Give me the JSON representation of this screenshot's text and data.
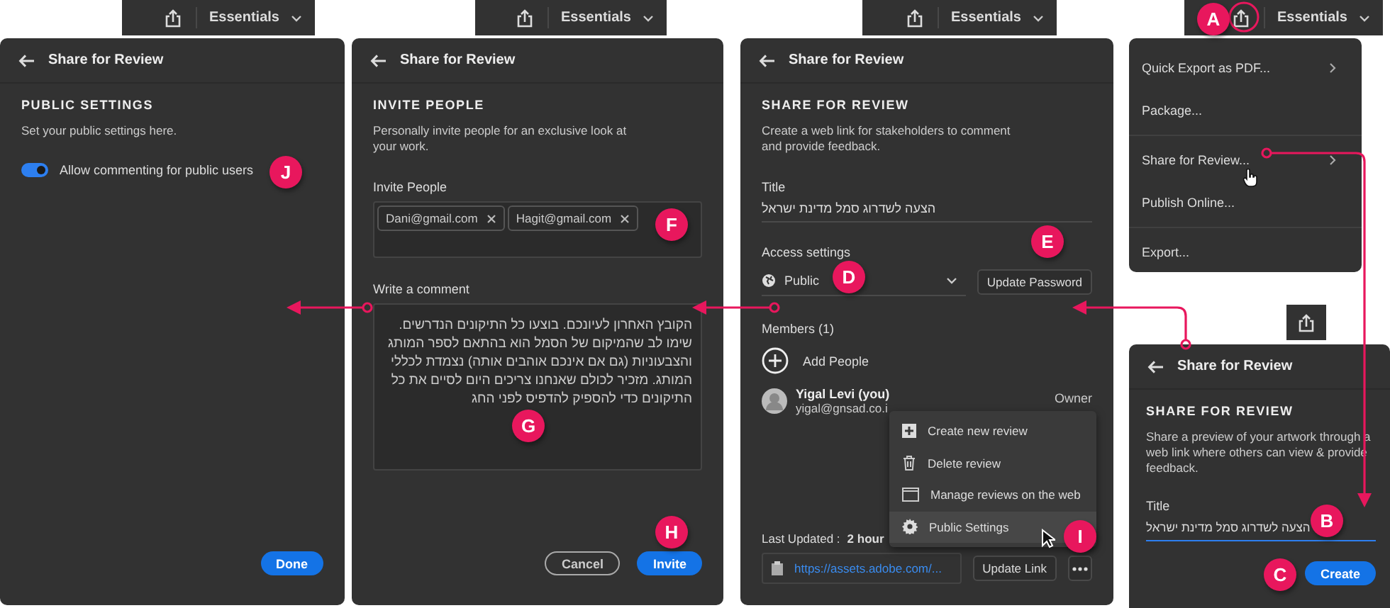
{
  "public_settings_panel": {
    "toolbar": {
      "label": "Essentials"
    },
    "header": "Share for Review",
    "heading": "PUBLIC SETTINGS",
    "description": "Set your public settings here.",
    "toggle": {
      "label": "Allow commenting for public users",
      "on": true
    },
    "done_button": "Done"
  },
  "invite_panel": {
    "toolbar": {
      "label": "Essentials"
    },
    "header": "Share for Review",
    "heading": "INVITE PEOPLE",
    "description": "Personally invite people for an exclusive look at your work.",
    "invite_label": "Invite People",
    "tags": [
      {
        "label": "Dani@gmail.com"
      },
      {
        "label": "Hagit@gmail.com"
      }
    ],
    "comment_label": "Write a comment",
    "comment": "הקובץ האחרון לעיונכם. בוצעו כל התיקונים הנדרשים. שימו לב שהמיקום של הסמל הוא בהתאם לספר המותג והצבעוניות (גם אם אינכם אוהבים אותה) נצמדת לכללי המותג. מזכיר לכולם שאנחנו צריכים היום לסיים את כל התיקונים כדי להספיק להדפיס לפני החג",
    "cancel_button": "Cancel",
    "invite_button": "Invite"
  },
  "review_panel": {
    "toolbar": {
      "label": "Essentials"
    },
    "header": "Share for Review",
    "heading": "SHARE FOR REVIEW",
    "description": "Create a web link for stakeholders to comment and provide feedback.",
    "title_label": "Title",
    "title_value": "הצעה לשדרוג סמל מדינת ישראל",
    "access_label": "Access settings",
    "access_value": "Public",
    "update_password_button": "Update Password",
    "members_label": "Members (1)",
    "add_people": "Add People",
    "member": {
      "name": "Yigal Levi (you)",
      "email": "yigal@gnsad.co.i",
      "role": "Owner"
    },
    "last_updated_label": "Last Updated :",
    "last_updated_value": "2 hour",
    "link": "https://assets.adobe.com/...",
    "update_link_button": "Update Link",
    "context_menu": [
      {
        "kind": "new",
        "label": "Create new review",
        "selected": false
      },
      {
        "kind": "delete",
        "label": "Delete review",
        "selected": false
      },
      {
        "kind": "manage",
        "label": "Manage reviews on the web",
        "selected": false
      },
      {
        "kind": "settings",
        "label": "Public Settings",
        "selected": true
      }
    ]
  },
  "export_menu": {
    "toolbar": {
      "label": "Essentials"
    },
    "groups": [
      [
        {
          "label": "Quick Export as PDF...",
          "submenu": true
        },
        {
          "label": "Package...",
          "submenu": false
        }
      ],
      [
        {
          "label": "Share for Review...",
          "submenu": true
        },
        {
          "label": "Publish Online...",
          "submenu": false
        }
      ],
      [
        {
          "label": "Export...",
          "submenu": false
        }
      ]
    ]
  },
  "create_panel": {
    "header": "Share for Review",
    "heading": "SHARE FOR REVIEW",
    "description": "Share a preview of your artwork through a web link  where others can view & provide feedback.",
    "title_label": "Title",
    "title_value": "הצעה לשדרוג סמל מדינת ישראל",
    "create_button": "Create"
  },
  "callouts": [
    "A",
    "B",
    "C",
    "D",
    "E",
    "F",
    "G",
    "H",
    "I",
    "J"
  ]
}
